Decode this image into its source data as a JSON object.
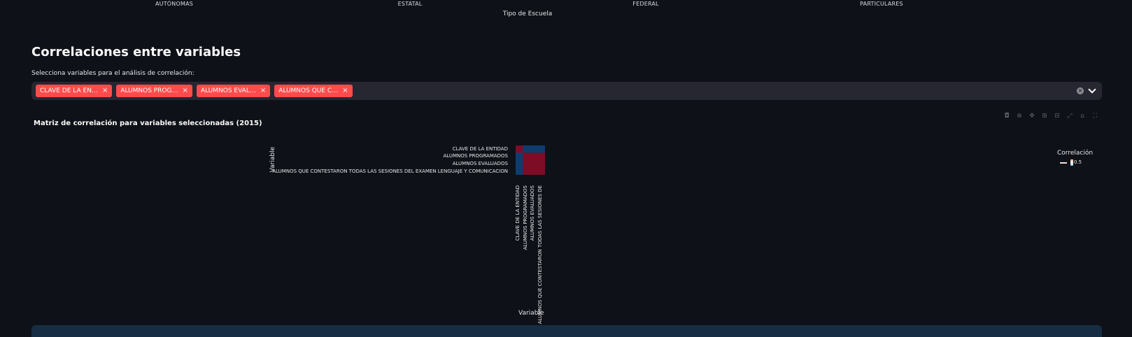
{
  "top_axis": {
    "categories": [
      "AUTÓNOMAS",
      "ESTATAL",
      "FEDERAL",
      "PARTICULARES"
    ],
    "title": "Tipo de Escuela"
  },
  "section": {
    "title": "Correlaciones entre variables"
  },
  "multiselect": {
    "label": "Selecciona variables para el análisis de correlación:",
    "chips": [
      {
        "label": "CLAVE DE LA EN…",
        "remove": "×"
      },
      {
        "label": "ALUMNOS PROG…",
        "remove": "×"
      },
      {
        "label": "ALUMNOS EVAL…",
        "remove": "×"
      },
      {
        "label": "ALUMNOS QUE C…",
        "remove": "×"
      }
    ],
    "clear_icon": "×"
  },
  "chart": {
    "title": "Matriz de correlación para variables seleccionadas (2015)",
    "modebar_icons": [
      "camera-icon",
      "zoom-icon",
      "pan-icon",
      "zoom-in-icon",
      "zoom-out-icon",
      "autoscale-icon",
      "reset-icon",
      "fullscreen-icon"
    ]
  },
  "chart_data": {
    "type": "heatmap",
    "title": "Matriz de correlación para variables seleccionadas (2015)",
    "xlabel": "Variable",
    "ylabel": "Variable",
    "rows": [
      "CLAVE DE LA ENTIDAD",
      "ALUMNOS  PROGRAMADOS",
      "ALUMNOS EVALUADOS",
      "ALUMNOS QUE CONTESTARON TODAS LAS SESIONES DEL EXAMEN LENGUAJE Y COMUNICACION"
    ],
    "columns": [
      "CLAVE DE LA ENTIDAD",
      "ALUMNOS  PROGRAMADOS",
      "ALUMNOS EVALUADOS",
      "ALUMNOS QUE CONTESTARON TODAS LAS SESIONES DE"
    ],
    "values": [
      [
        1.0,
        0.0,
        0.0,
        0.0
      ],
      [
        0.0,
        1.0,
        1.0,
        1.0
      ],
      [
        0.0,
        1.0,
        1.0,
        1.0
      ],
      [
        0.0,
        1.0,
        1.0,
        1.0
      ]
    ],
    "legend_title": "Correlación",
    "legend_tick": "0.5",
    "colors": {
      "high": "#7d0c27",
      "low": "#0e3c6e"
    }
  }
}
